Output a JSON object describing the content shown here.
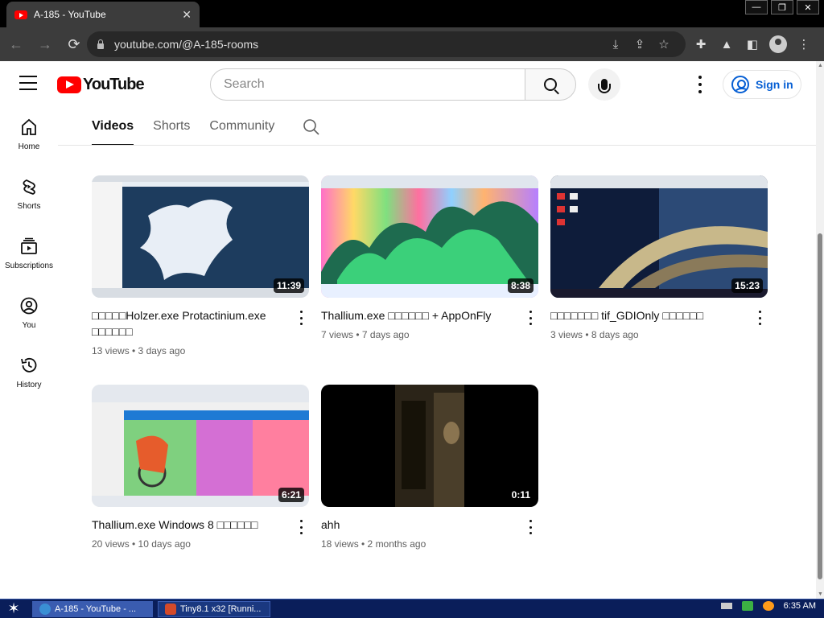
{
  "browser": {
    "tab_title": "A-185 - YouTube",
    "tab_close": "✕",
    "url": "youtube.com/@A-185-rooms",
    "win_minimize": "—",
    "win_restore": "❐",
    "win_close": "✕"
  },
  "masthead": {
    "logo_text": "YouTube",
    "search_placeholder": "Search",
    "signin_label": "Sign in"
  },
  "sidebar": {
    "items": [
      {
        "label": "Home",
        "icon": "home-icon"
      },
      {
        "label": "Shorts",
        "icon": "shorts-icon"
      },
      {
        "label": "Subscriptions",
        "icon": "subscriptions-icon"
      },
      {
        "label": "You",
        "icon": "you-icon"
      },
      {
        "label": "History",
        "icon": "history-icon"
      }
    ]
  },
  "channel_tabs": [
    {
      "label": "Videos",
      "active": true
    },
    {
      "label": "Shorts",
      "active": false
    },
    {
      "label": "Community",
      "active": false
    }
  ],
  "videos": [
    {
      "title": "□□□□□Holzer.exe Protactinium.exe □□□□□□",
      "meta": "13 views • 3 days ago",
      "duration": "11:39"
    },
    {
      "title": "Thallium.exe □□□□□□ + AppOnFly",
      "meta": "7 views • 7 days ago",
      "duration": "8:38"
    },
    {
      "title": "□□□□□□□ tif_GDIOnly □□□□□□",
      "meta": "3 views • 8 days ago",
      "duration": "15:23"
    },
    {
      "title": "Thallium.exe Windows 8 □□□□□□",
      "meta": "20 views • 10 days ago",
      "duration": "6:21"
    },
    {
      "title": "ahh",
      "meta": "18 views • 2 months ago",
      "duration": "0:11"
    }
  ],
  "taskbar": {
    "start_glyph": "✶",
    "items": [
      {
        "label": "A-185 - YouTube - ...",
        "active": true
      },
      {
        "label": "Tiny8.1 x32 [Runni...",
        "active": false
      }
    ],
    "clock": "6:35 AM"
  },
  "colors": {
    "youtube_red": "#ff0000",
    "link_blue": "#065fd4",
    "taskbar_blue": "#0a1e5a"
  }
}
